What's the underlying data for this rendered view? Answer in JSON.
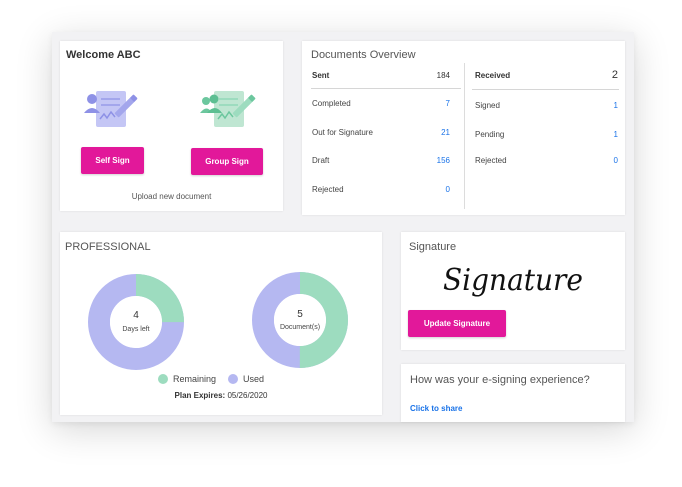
{
  "welcome": {
    "title": "Welcome ABC",
    "self_sign_label": "Self Sign",
    "group_sign_label": "Group Sign",
    "upload_text": "Upload new document"
  },
  "documents": {
    "title": "Documents Overview",
    "sent": {
      "label": "Sent",
      "count": "184",
      "rows": [
        {
          "label": "Completed",
          "value": "7"
        },
        {
          "label": "Out for Signature",
          "value": "21"
        },
        {
          "label": "Draft",
          "value": "156"
        },
        {
          "label": "Rejected",
          "value": "0"
        }
      ]
    },
    "received": {
      "label": "Received",
      "count": "2",
      "rows": [
        {
          "label": "Signed",
          "value": "1"
        },
        {
          "label": "Pending",
          "value": "1"
        },
        {
          "label": "Rejected",
          "value": "0"
        }
      ]
    }
  },
  "professional": {
    "title": "PROFESSIONAL",
    "days_left": {
      "value": "4",
      "label": "Days left",
      "remaining_fraction": 0.25
    },
    "documents": {
      "value": "5",
      "label": "Document(s)",
      "remaining_fraction": 0.5
    },
    "legend": {
      "remaining": "Remaining",
      "used": "Used"
    },
    "plan_label": "Plan Expires:",
    "plan_date": "05/26/2020",
    "colors": {
      "remaining": "#9ddcbf",
      "used": "#b5b8f1"
    }
  },
  "signature": {
    "title": "Signature",
    "signature_text": "Signature",
    "update_label": "Update Signature"
  },
  "feedback": {
    "question": "How was your e-signing experience?",
    "link": "Click to share"
  },
  "colors": {
    "accent": "#e2189a",
    "link": "#1a73e8"
  }
}
